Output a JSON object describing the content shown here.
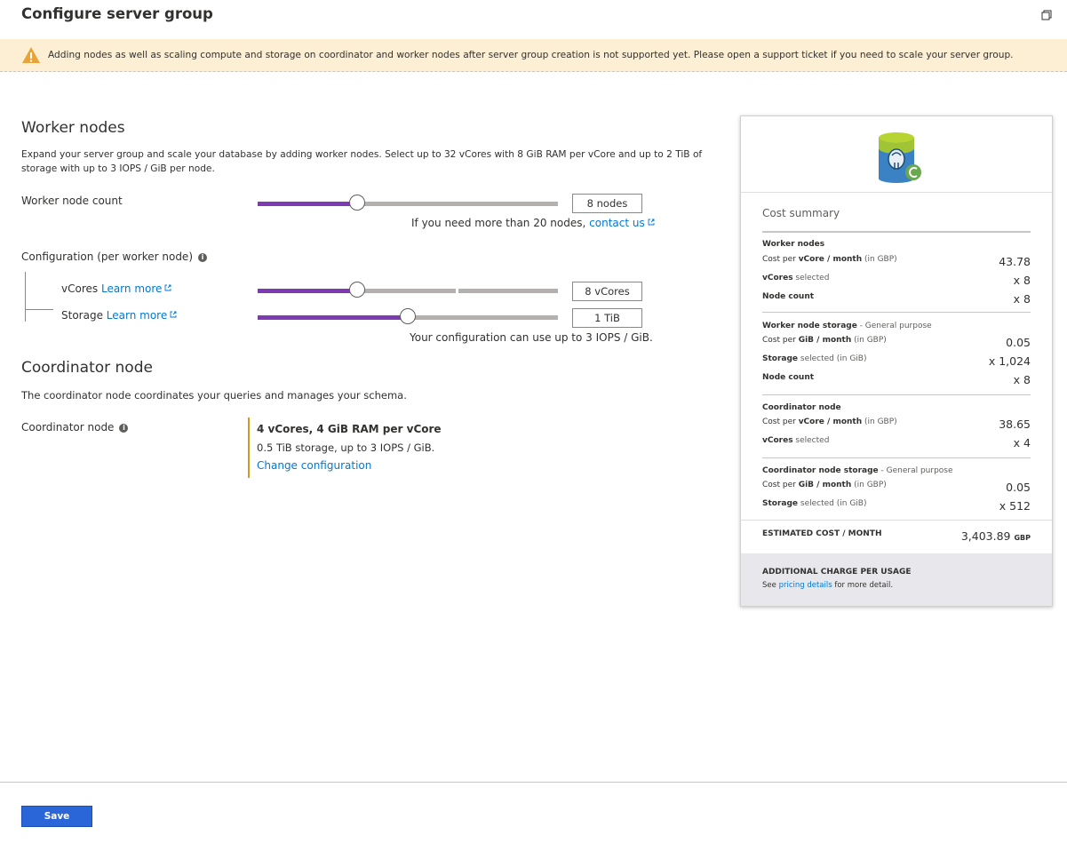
{
  "header": {
    "title": "Configure server group"
  },
  "banner": {
    "text": "Adding nodes as well as scaling compute and storage on coordinator and worker nodes after server group creation is not supported yet. Please open a support ticket if you need to scale your server group."
  },
  "worker_nodes": {
    "heading": "Worker nodes",
    "description": "Expand your server group and scale your database by adding worker nodes. Select up to 32 vCores with 8 GiB RAM per vCore and up to 2 TiB of storage with up to 3 IOPS / GiB per node.",
    "count_label": "Worker node count",
    "count_value": "8 nodes",
    "count_slider_fraction": 0.33,
    "more_nodes_text": "If you need more than 20 nodes,",
    "contact_link": "contact us",
    "config_label": "Configuration (per worker node)",
    "vcores_label": "vCores",
    "storage_label": "Storage",
    "learn_more": "Learn more",
    "vcores_value": "8 vCores",
    "vcores_slider_fraction": 0.33,
    "storage_value": "1 TiB",
    "storage_slider_fraction": 0.5,
    "iops_note": "Your configuration can use up to 3 IOPS / GiB."
  },
  "coordinator": {
    "heading": "Coordinator node",
    "description": "The coordinator node coordinates your queries and manages your schema.",
    "label": "Coordinator node",
    "config_title": "4 vCores, 4 GiB RAM per vCore",
    "config_detail": "0.5 TiB storage, up to 3 IOPS / GiB.",
    "change_link": "Change configuration"
  },
  "cost_summary": {
    "title": "Cost summary",
    "worker_nodes": {
      "heading": "Worker nodes",
      "cost_prefix": "Cost per ",
      "cost_bold": "vCore / month",
      "cost_suffix": " (in GBP)",
      "cost_value": "43.78",
      "vcores_bold": "vCores",
      "vcores_suffix": " selected",
      "vcores_value": "x 8",
      "node_count_label": "Node count",
      "node_count_value": "x 8"
    },
    "worker_storage": {
      "heading": "Worker node storage",
      "heading_suffix": " - General purpose",
      "cost_prefix": "Cost per ",
      "cost_bold": "GiB / month",
      "cost_suffix": " (in GBP)",
      "cost_value": "0.05",
      "storage_bold": "Storage",
      "storage_suffix": " selected (in GiB)",
      "storage_value": "x 1,024",
      "node_count_label": "Node count",
      "node_count_value": "x 8"
    },
    "coordinator_node": {
      "heading": "Coordinator node",
      "cost_prefix": "Cost per ",
      "cost_bold": "vCore / month",
      "cost_suffix": " (in GBP)",
      "cost_value": "38.65",
      "vcores_bold": "vCores",
      "vcores_suffix": " selected",
      "vcores_value": "x 4"
    },
    "coordinator_storage": {
      "heading": "Coordinator node storage",
      "heading_suffix": " - General purpose",
      "cost_prefix": "Cost per ",
      "cost_bold": "GiB / month",
      "cost_suffix": " (in GBP)",
      "cost_value": "0.05",
      "storage_bold": "Storage",
      "storage_suffix": " selected (in GiB)",
      "storage_value": "x 512"
    },
    "estimated_label": "ESTIMATED COST / MONTH",
    "estimated_value": "3,403.89",
    "currency": "GBP",
    "additional_heading": "ADDITIONAL CHARGE PER USAGE",
    "additional_prefix": "See ",
    "pricing_link": "pricing details",
    "additional_suffix": " for more detail."
  },
  "footer": {
    "save_label": "Save"
  },
  "colors": {
    "slider_fill": "#7e3ab0",
    "link": "#0078d4",
    "banner_bg": "#fcefd4",
    "warning": "#e8a33b",
    "coordinator_accent": "#d39b1e",
    "save_button": "#2b66d9"
  },
  "icons": {
    "warning": "warning-triangle-icon",
    "maximize": "restore-window-icon",
    "info": "info-icon",
    "external_link": "external-link-icon",
    "database": "postgresql-database-icon"
  }
}
